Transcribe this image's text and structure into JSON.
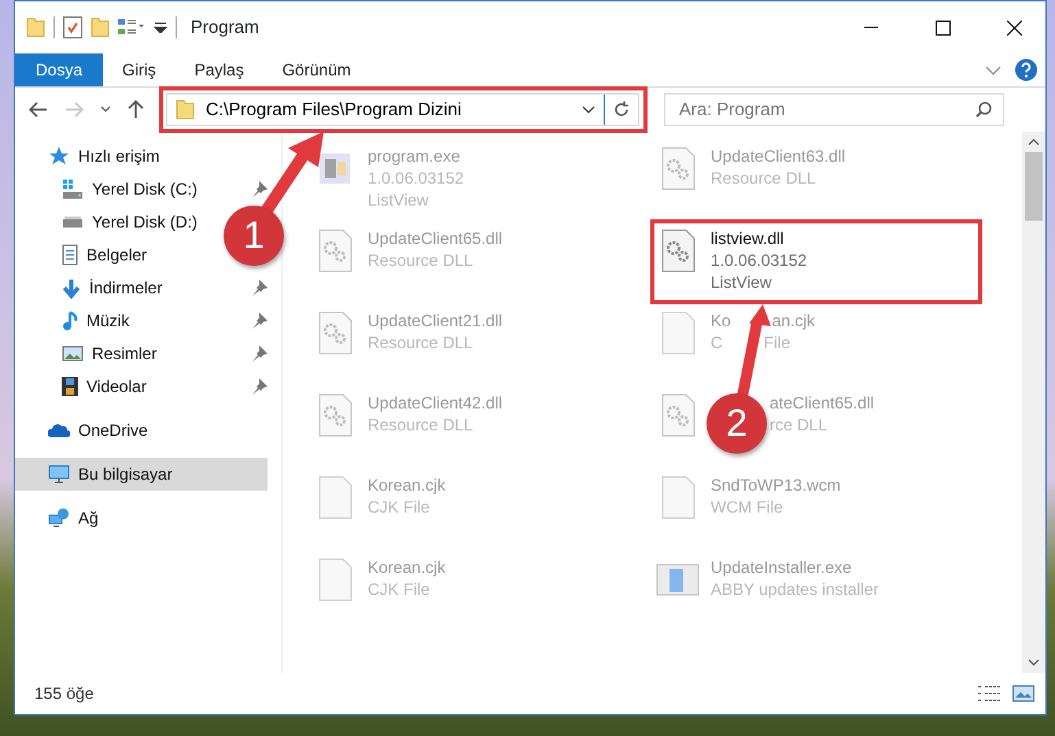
{
  "window": {
    "title": "Program"
  },
  "ribbon_tabs": [
    {
      "label": "Dosya",
      "selected": true
    },
    {
      "label": "Giriş",
      "selected": false
    },
    {
      "label": "Paylaş",
      "selected": false
    },
    {
      "label": "Görünüm",
      "selected": false
    }
  ],
  "address_bar": {
    "path": "C:\\Program Files\\Program Dizini",
    "forward_disabled": true
  },
  "search": {
    "placeholder": "Ara: Program"
  },
  "sidebar": {
    "items": [
      {
        "label": "Hızlı erişim",
        "kind": "star",
        "selected": false,
        "children": [
          {
            "label": "Yerel Disk (C:)",
            "kind": "drive-win",
            "pinned": true,
            "selected": false
          },
          {
            "label": "Yerel Disk (D:)",
            "kind": "drive",
            "selected": false
          },
          {
            "label": "Belgeler",
            "kind": "docs",
            "selected": false
          },
          {
            "label": "İndirmeler",
            "kind": "download",
            "pinned": true,
            "selected": false
          },
          {
            "label": "Müzik",
            "kind": "music",
            "pinned": true,
            "selected": false
          },
          {
            "label": "Resimler",
            "kind": "pictures",
            "pinned": true,
            "selected": false
          },
          {
            "label": "Videolar",
            "kind": "videos",
            "pinned": true,
            "selected": false
          }
        ]
      },
      {
        "label": "OneDrive",
        "kind": "cloud",
        "selected": false
      },
      {
        "label": "Bu bilgisayar",
        "kind": "pc",
        "selected": true
      },
      {
        "label": "Ağ",
        "kind": "network",
        "selected": false
      }
    ]
  },
  "files": [
    {
      "name": [
        "program.exe"
      ],
      "lines": [
        [
          "1.0.06.03152"
        ],
        [
          "ListView"
        ]
      ],
      "kind": "exe",
      "focused": false
    },
    {
      "name": [
        "UpdateClient63.dll"
      ],
      "lines": [
        [
          "Resource DLL"
        ]
      ],
      "kind": "dll",
      "focused": false
    },
    {
      "name": [
        "UpdateClient65.dll"
      ],
      "lines": [
        [
          "Resource DLL"
        ]
      ],
      "kind": "dll",
      "focused": false
    },
    {
      "name": [
        "listview.dll"
      ],
      "lines": [
        [
          "1.0.06.03152"
        ],
        [
          "ListView"
        ]
      ],
      "kind": "dll",
      "focused": true
    },
    {
      "name": [
        "UpdateClient21.dll"
      ],
      "lines": [
        [
          "Resource DLL"
        ]
      ],
      "kind": "dll",
      "focused": false
    },
    {
      "name": [
        "Ko",
        "an.cjk"
      ],
      "lines": [
        [
          "C",
          "File"
        ]
      ],
      "kind": "file",
      "focused": false
    },
    {
      "name": [
        "UpdateClient42.dll"
      ],
      "lines": [
        [
          "Resource DLL"
        ]
      ],
      "kind": "dll",
      "focused": false
    },
    {
      "name": [
        "ateClient65.dll"
      ],
      "lines": [
        [
          "rce DLL"
        ]
      ],
      "kind": "dll",
      "focused": false,
      "covered_start": true
    },
    {
      "name": [
        "Korean.cjk"
      ],
      "lines": [
        [
          "CJK File"
        ]
      ],
      "kind": "file",
      "focused": false
    },
    {
      "name": [
        "SndToWP13.wcm"
      ],
      "lines": [
        [
          "WCM File"
        ]
      ],
      "kind": "file",
      "focused": false
    },
    {
      "name": [
        "Korean.cjk"
      ],
      "lines": [
        [
          "CJK File"
        ]
      ],
      "kind": "file",
      "focused": false
    },
    {
      "name": [
        "UpdateInstaller.exe"
      ],
      "lines": [
        [
          "ABBY updates installer"
        ]
      ],
      "kind": "installer",
      "focused": false
    }
  ],
  "status_bar": {
    "count": "155 öğe"
  },
  "annotations": [
    {
      "number": "1"
    },
    {
      "number": "2"
    }
  ]
}
